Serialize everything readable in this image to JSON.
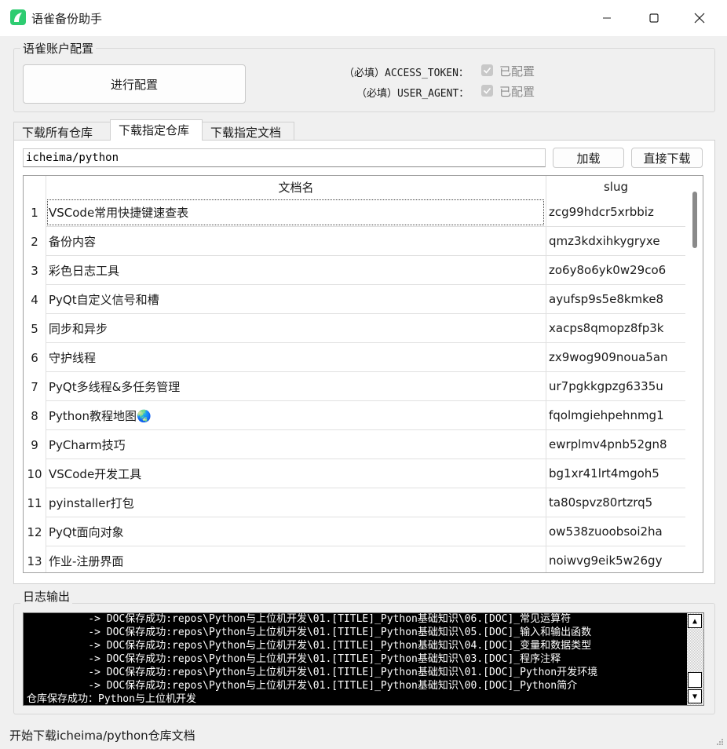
{
  "window": {
    "title": "语雀备份助手",
    "accent_color": "#2ecc71"
  },
  "account_config": {
    "group_title": "语雀账户配置",
    "config_button": "进行配置",
    "access_token_label": "（必填）ACCESS_TOKEN：",
    "access_token_status": "已配置",
    "user_agent_label": "（必填）USER_AGENT：",
    "user_agent_status": "已配置"
  },
  "tabs": [
    {
      "label": "下载所有仓库",
      "active": false
    },
    {
      "label": "下载指定仓库",
      "active": true
    },
    {
      "label": "下载指定文档",
      "active": false
    }
  ],
  "repo_panel": {
    "repo_input_value": "icheima/python",
    "load_button": "加载",
    "direct_download_button": "直接下载"
  },
  "doc_table": {
    "columns": [
      "文档名",
      "slug"
    ],
    "rows": [
      {
        "num": "1",
        "name": "VSCode常用快捷键速查表",
        "slug": "zcg99hdcr5xrbbiz"
      },
      {
        "num": "2",
        "name": "备份内容",
        "slug": "qmz3kdxihkygryxe"
      },
      {
        "num": "3",
        "name": "彩色日志工具",
        "slug": "zo6y8o6yk0w29co6"
      },
      {
        "num": "4",
        "name": "PyQt自定义信号和槽",
        "slug": "ayufsp9s5e8kmke8"
      },
      {
        "num": "5",
        "name": "同步和异步",
        "slug": "xacps8qmopz8fp3k"
      },
      {
        "num": "6",
        "name": "守护线程",
        "slug": "zx9wog909noua5an"
      },
      {
        "num": "7",
        "name": "PyQt多线程&多任务管理",
        "slug": "ur7pgkkgpzg6335u"
      },
      {
        "num": "8",
        "name": "Python教程地图🌏",
        "slug": "fqolmgiehpehnmg1"
      },
      {
        "num": "9",
        "name": "PyCharm技巧",
        "slug": "ewrplmv4pnb52gn8"
      },
      {
        "num": "10",
        "name": "VSCode开发工具",
        "slug": "bg1xr41lrt4mgoh5"
      },
      {
        "num": "11",
        "name": "pyinstaller打包",
        "slug": "ta80spvz80rtzrq5"
      },
      {
        "num": "12",
        "name": "PyQt面向对象",
        "slug": "ow538zuoobsoi2ha"
      },
      {
        "num": "13",
        "name": "作业-注册界面",
        "slug": "noiwvg9eik5w26gy"
      }
    ]
  },
  "log_output": {
    "group_title": "日志输出",
    "lines": [
      "          -> DOC保存成功:repos\\Python与上位机开发\\01.[TITLE]_Python基础知识\\06.[DOC]_常见运算符",
      "          -> DOC保存成功:repos\\Python与上位机开发\\01.[TITLE]_Python基础知识\\05.[DOC]_输入和输出函数",
      "          -> DOC保存成功:repos\\Python与上位机开发\\01.[TITLE]_Python基础知识\\04.[DOC]_变量和数据类型",
      "          -> DOC保存成功:repos\\Python与上位机开发\\01.[TITLE]_Python基础知识\\03.[DOC]_程序注释",
      "          -> DOC保存成功:repos\\Python与上位机开发\\01.[TITLE]_Python基础知识\\01.[DOC]_Python开发环境",
      "          -> DOC保存成功:repos\\Python与上位机开发\\01.[TITLE]_Python基础知识\\00.[DOC]_Python简介",
      "仓库保存成功：Python与上位机开发"
    ]
  },
  "status_bar": {
    "message": "开始下载icheima/python仓库文档"
  }
}
